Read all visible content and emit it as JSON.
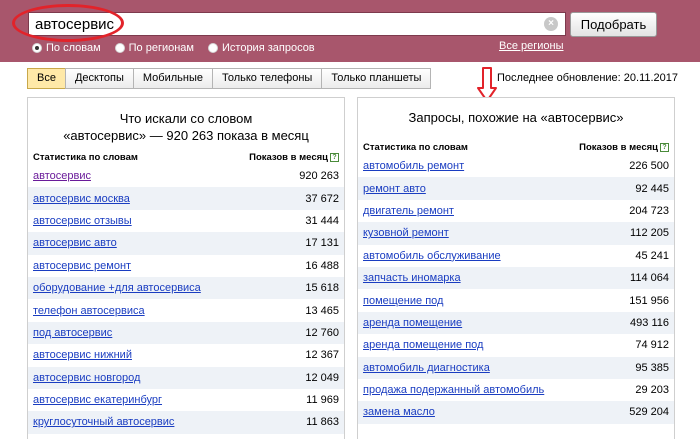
{
  "search": {
    "value": "автосервис",
    "submit_label": "Подобрать",
    "clear_symbol": "×"
  },
  "modes": [
    {
      "label": "По словам",
      "selected": true
    },
    {
      "label": "По регионам",
      "selected": false
    },
    {
      "label": "История запросов",
      "selected": false
    }
  ],
  "all_regions_label": "Все регионы",
  "tabs": [
    {
      "label": "Все",
      "active": true
    },
    {
      "label": "Десктопы",
      "active": false
    },
    {
      "label": "Мобильные",
      "active": false
    },
    {
      "label": "Только телефоны",
      "active": false
    },
    {
      "label": "Только планшеты",
      "active": false
    }
  ],
  "updated_label": "Последнее обновление: 20.11.2017",
  "left_panel": {
    "title_line1": "Что искали со словом",
    "title_line2": "«автосервис» — 920 263 показа в месяц",
    "col_keyword": "Статистика по словам",
    "col_count": "Показов в месяц",
    "help_symbol": "?",
    "rows": [
      {
        "keyword": "автосервис",
        "count": "920 263"
      },
      {
        "keyword": "автосервис москва",
        "count": "37 672"
      },
      {
        "keyword": "автосервис отзывы",
        "count": "31 444"
      },
      {
        "keyword": "автосервис авто",
        "count": "17 131"
      },
      {
        "keyword": "автосервис ремонт",
        "count": "16 488"
      },
      {
        "keyword": "оборудование +для автосервиса",
        "count": "15 618"
      },
      {
        "keyword": "телефон автосервиса",
        "count": "13 465"
      },
      {
        "keyword": "под автосервис",
        "count": "12 760"
      },
      {
        "keyword": "автосервис нижний",
        "count": "12 367"
      },
      {
        "keyword": "автосервис новгород",
        "count": "12 049"
      },
      {
        "keyword": "автосервис екатеринбург",
        "count": "11 969"
      },
      {
        "keyword": "круглосуточный автосервис",
        "count": "11 863"
      }
    ]
  },
  "right_panel": {
    "title": "Запросы, похожие на «автосервис»",
    "col_keyword": "Статистика по словам",
    "col_count": "Показов в месяц",
    "help_symbol": "?",
    "rows": [
      {
        "keyword": "автомобиль ремонт",
        "count": "226 500"
      },
      {
        "keyword": "ремонт авто",
        "count": "92 445"
      },
      {
        "keyword": "двигатель ремонт",
        "count": "204 723"
      },
      {
        "keyword": "кузовной ремонт",
        "count": "112 205"
      },
      {
        "keyword": "автомобиль обслуживание",
        "count": "45 241"
      },
      {
        "keyword": "запчасть иномарка",
        "count": "114 064"
      },
      {
        "keyword": "помещение под",
        "count": "151 956"
      },
      {
        "keyword": "аренда помещение",
        "count": "493 116"
      },
      {
        "keyword": "аренда помещение под",
        "count": "74 912"
      },
      {
        "keyword": "автомобиль диагностика",
        "count": "95 385"
      },
      {
        "keyword": "продажа подержанный автомобиль",
        "count": "29 203"
      },
      {
        "keyword": "замена масло",
        "count": "529 204"
      }
    ]
  },
  "colors": {
    "header_bg": "#a8566c",
    "link": "#1a3dc1",
    "annotation_red": "#e2232a",
    "active_tab": "#ffe9a8"
  }
}
